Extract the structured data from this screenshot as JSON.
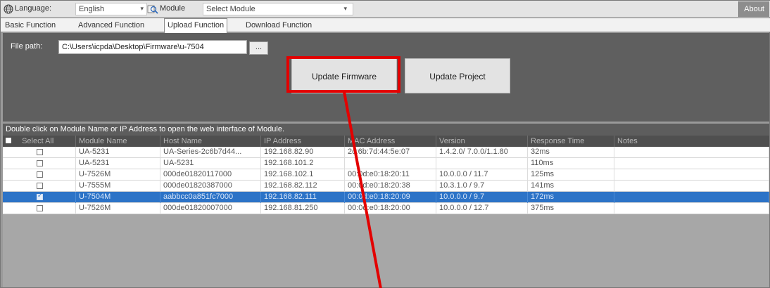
{
  "toolbar": {
    "language_label": "Language:",
    "language_value": "English",
    "module_label": "Module",
    "module_value": "Select Module",
    "about_label": "About"
  },
  "tabs": [
    {
      "label": "Basic Function"
    },
    {
      "label": "Advanced Function"
    },
    {
      "label": "Upload Function"
    },
    {
      "label": "Download Function"
    }
  ],
  "upload": {
    "file_path_label": "File path:",
    "file_path_value": "C:\\Users\\icpda\\Desktop\\Firmware\\u-7504",
    "browse_label": "...",
    "update_firmware_label": "Update Firmware",
    "update_project_label": "Update Project"
  },
  "info_text": "Double click on Module Name or IP Address to open the web interface of Module.",
  "table": {
    "headers": [
      "Select All",
      "Module Name",
      "Host Name",
      "IP Address",
      "MAC Address",
      "Version",
      "Response Time",
      "Notes"
    ],
    "rows": [
      {
        "module": "UA-5231",
        "host": "UA-Series-2c6b7d44...",
        "ip": "192.168.82.90",
        "mac": "2c:6b:7d:44:5e:07",
        "version": "1.4.2.0/ 7.0.0/1.1.80",
        "response": "32ms",
        "notes": ""
      },
      {
        "module": "UA-5231",
        "host": "UA-5231",
        "ip": "192.168.101.2",
        "mac": "",
        "version": "",
        "response": "110ms",
        "notes": ""
      },
      {
        "module": "U-7526M",
        "host": "000de01820117000",
        "ip": "192.168.102.1",
        "mac": "00:0d:e0:18:20:11",
        "version": "10.0.0.0 / 11.7",
        "response": "125ms",
        "notes": ""
      },
      {
        "module": "U-7555M",
        "host": "000de01820387000",
        "ip": "192.168.82.112",
        "mac": "00:0d:e0:18:20:38",
        "version": "10.3.1.0 / 9.7",
        "response": "141ms",
        "notes": ""
      },
      {
        "module": "U-7504M",
        "host": "aabbcc0a851fc7000",
        "ip": "192.168.82.111",
        "mac": "00:0d:e0:18:20:09",
        "version": "10.0.0.0 / 9.7",
        "response": "172ms",
        "notes": ""
      },
      {
        "module": "U-7526M",
        "host": "000de01820007000",
        "ip": "192.168.81.250",
        "mac": "00:0d:e0:18:20:00",
        "version": "10.0.0.0 / 12.7",
        "response": "375ms",
        "notes": ""
      }
    ]
  },
  "colors": {
    "selected_row": "#2c73c7",
    "highlight": "#e30000"
  }
}
